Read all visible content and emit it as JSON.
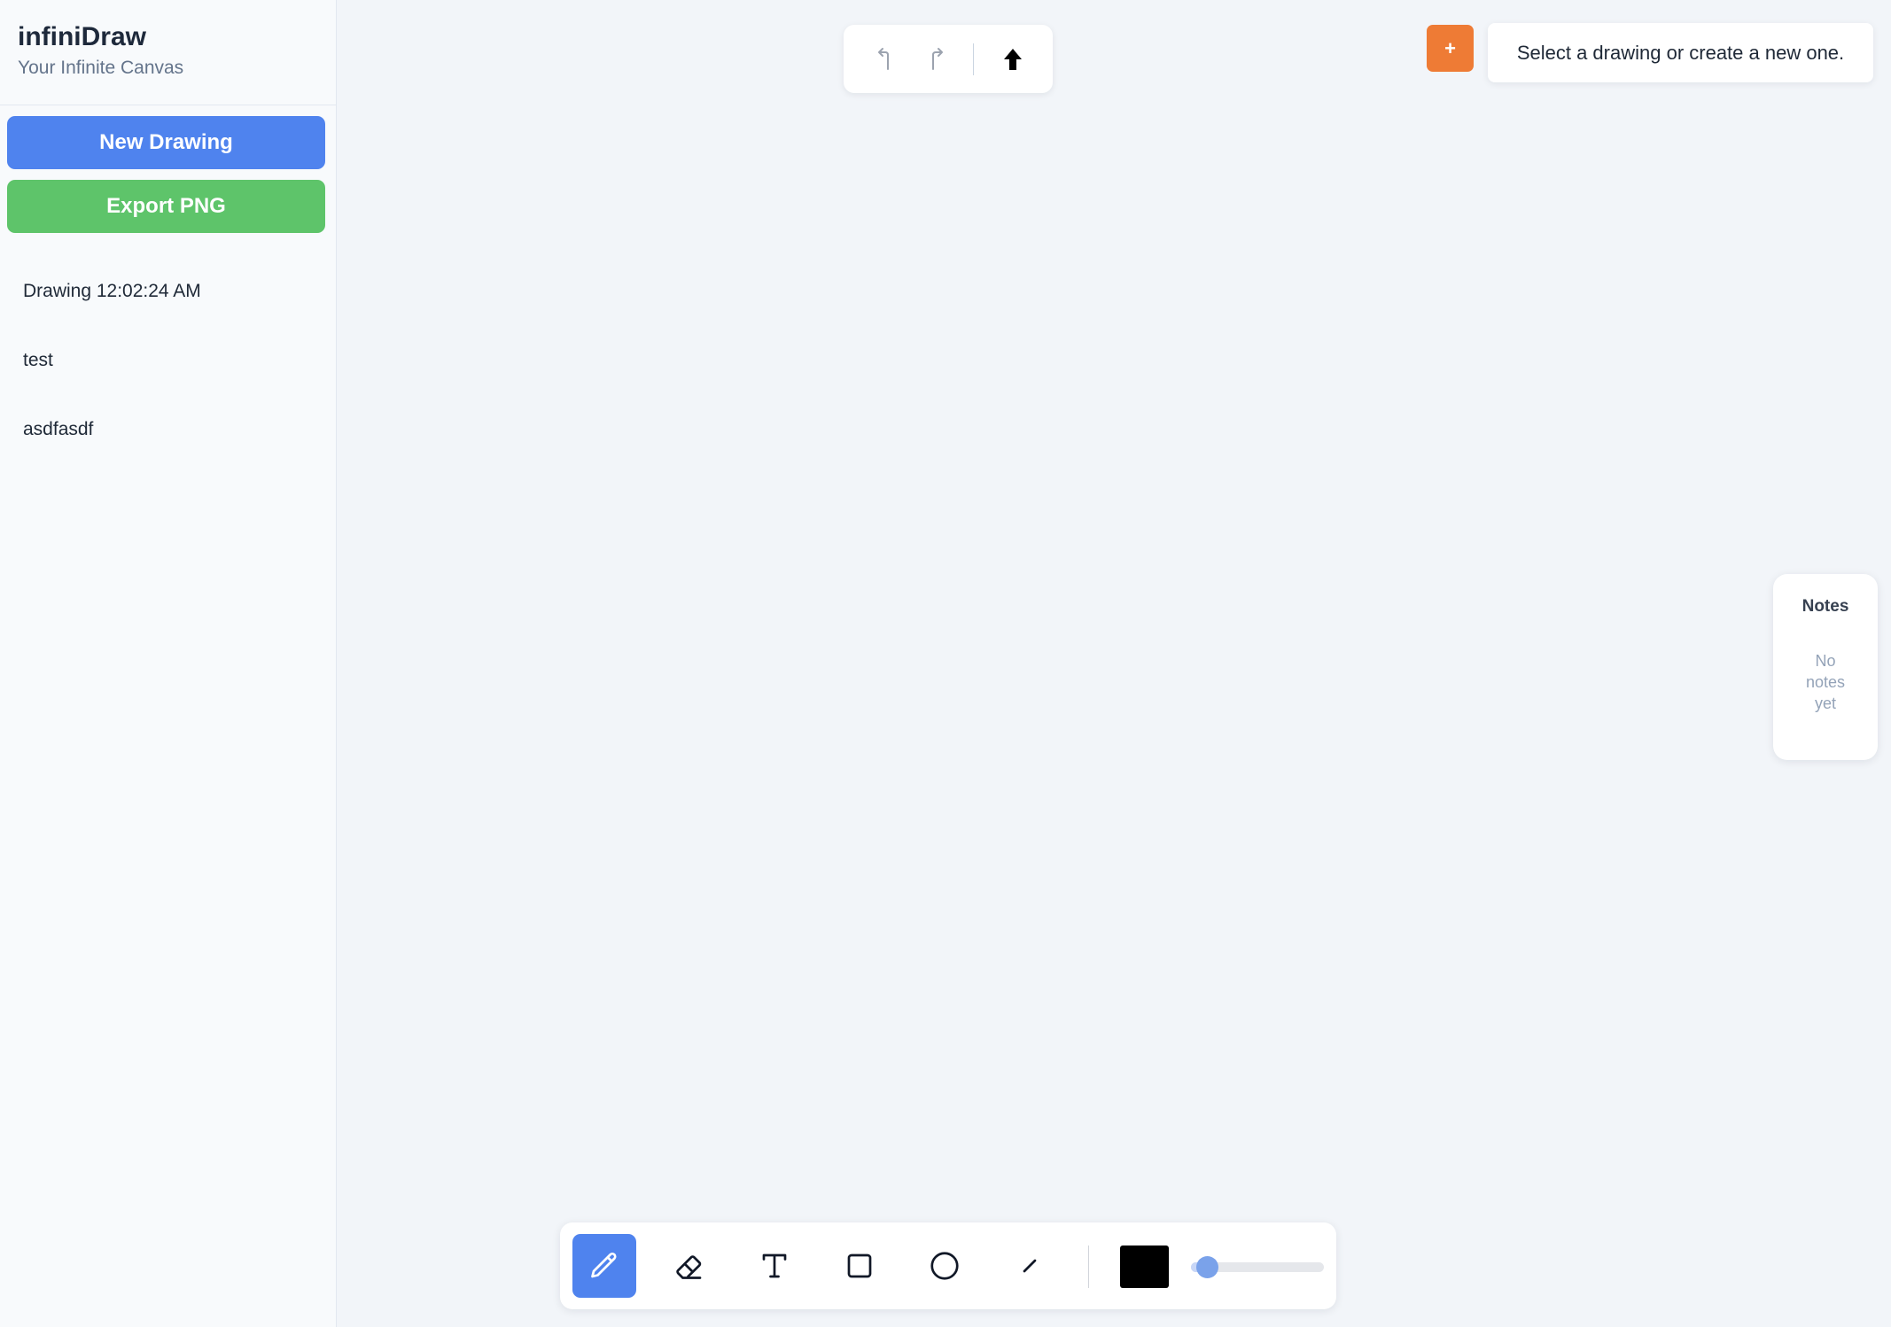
{
  "app": {
    "title": "infiniDraw",
    "subtitle": "Your Infinite Canvas"
  },
  "sidebar": {
    "new_drawing_label": "New Drawing",
    "export_label": "Export PNG",
    "drawings": [
      {
        "label": "Drawing 12:02:24 AM"
      },
      {
        "label": "test"
      },
      {
        "label": "asdfasdf"
      }
    ]
  },
  "top_toolbar": {
    "icons": [
      "undo-icon",
      "redo-icon",
      "arrow-up-icon"
    ]
  },
  "top_right": {
    "add_label": "+",
    "status_message": "Select a drawing or create a new one."
  },
  "notes": {
    "title": "Notes",
    "empty_text": "No notes yet"
  },
  "bottom_toolbar": {
    "tools": [
      "pencil-icon",
      "eraser-icon",
      "text-icon",
      "rectangle-icon",
      "circle-icon",
      "line-icon"
    ],
    "active_tool": "pencil-icon",
    "stroke_color": "#000000",
    "stroke_width_fraction": 0.12
  },
  "colors": {
    "primary": "#4f83ee",
    "success": "#5ec46a",
    "accent": "#ee7b35",
    "canvas_background": "#f2f5f9"
  }
}
